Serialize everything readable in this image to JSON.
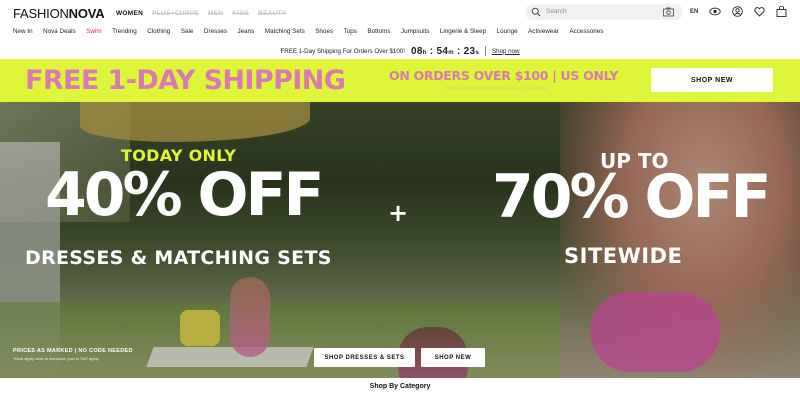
{
  "header": {
    "logo_light": "FASHION",
    "logo_bold": "NOVA",
    "categories": [
      {
        "label": "WOMEN",
        "active": true
      },
      {
        "label": "PLUS+CURVE",
        "active": false
      },
      {
        "label": "MEN",
        "active": false
      },
      {
        "label": "KIDS",
        "active": false
      },
      {
        "label": "BEAUTY",
        "active": false
      }
    ],
    "search_placeholder": "Search",
    "lang": "EN",
    "icons": [
      "search-icon",
      "camera-icon",
      "eye-icon",
      "account-icon",
      "heart-icon",
      "bag-icon"
    ]
  },
  "nav": {
    "items": [
      "New In",
      "Nova Deals",
      "Swim",
      "Trending",
      "Clothing",
      "Sale",
      "Dresses",
      "Jeans",
      "Matching Sets",
      "Shoes",
      "Tops",
      "Bottoms",
      "Jumpsuits",
      "Lingerie & Sleep",
      "Lounge",
      "Activewear",
      "Accessories"
    ]
  },
  "promo_bar": {
    "text": "FREE 1-Day Shipping For Orders Over $100!",
    "hours": "08",
    "h_unit": "h",
    "minutes": "54",
    "m_unit": "m",
    "seconds": "23",
    "s_unit": "s",
    "shop_link": "Shop now"
  },
  "banner": {
    "headline": "FREE 1-DAY SHIPPING",
    "sub": "ON ORDERS OVER $100 | US ONLY",
    "fine_print": "*Not valid with international orders. T&C Apply",
    "button": "SHOP NEW",
    "bg_color": "#dff53a",
    "text_color": "#d97ab2"
  },
  "hero": {
    "today_only": "TODAY ONLY",
    "left_big": "40% OFF",
    "left_sub": "DRESSES & MATCHING SETS",
    "plus": "+",
    "up_to": "UP TO",
    "right_big": "70% OFF",
    "right_sub": "SITEWIDE",
    "prices_note": "PRICES AS MARKED | NO CODE NEEDED",
    "prices_fine": "*Must apply code at checkout; promo T&C apply.",
    "btn_left": "SHOP DRESSES & SETS",
    "btn_right": "SHOP NEW"
  },
  "section": {
    "category_title": "Shop By Category"
  }
}
